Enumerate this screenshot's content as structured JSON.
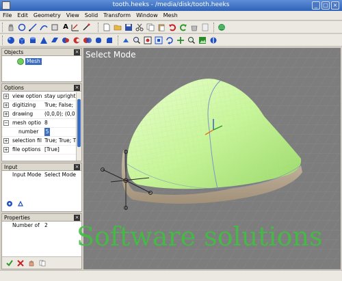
{
  "window": {
    "title": "tooth.heeks - /media/disk/tooth.heeks"
  },
  "menu": [
    "File",
    "Edit",
    "Geometry",
    "View",
    "Solid",
    "Transform",
    "Window",
    "Mesh"
  ],
  "objects": {
    "header": "Objects",
    "items": [
      {
        "label": "Mesh",
        "icon": "mesh-icon"
      }
    ]
  },
  "options": {
    "header": "Options",
    "rows": [
      {
        "expander": "+",
        "key": "view option",
        "value": "stay upright"
      },
      {
        "expander": "+",
        "key": "digitizing",
        "value": "True; False;"
      },
      {
        "expander": "+",
        "key": "drawing",
        "value": "(0,0,0); (0,0"
      },
      {
        "expander": "−",
        "key": "mesh optio",
        "value": "8"
      },
      {
        "expander": "",
        "key": "number",
        "value": "5"
      },
      {
        "expander": "+",
        "key": "selection fil",
        "value": "True; True; T"
      },
      {
        "expander": "+",
        "key": "file options",
        "value": "[True]"
      }
    ]
  },
  "input": {
    "header": "Input",
    "mode_label": "Input Mode",
    "mode_value": "Select Mode"
  },
  "properties": {
    "header": "Properties",
    "label": "Number of",
    "value": "2"
  },
  "viewport": {
    "mode_text": "Select Mode",
    "watermark": "Software solutions"
  },
  "colors": {
    "mesh_green": "#c8f59a",
    "watermark": "#3fbf3f",
    "viewport_bg": "#7f7f7f",
    "title_blue": "#3a6cc0"
  }
}
